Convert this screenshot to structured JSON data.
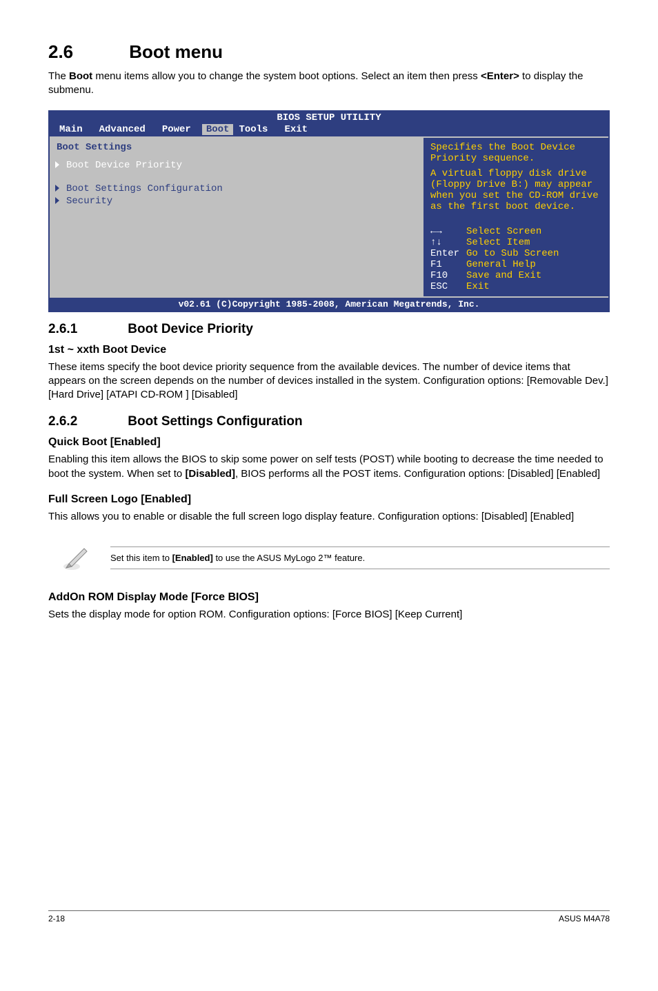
{
  "section_number": "2.6",
  "section_title": "Boot menu",
  "intro_text_1": "The ",
  "intro_bold_1": "Boot",
  "intro_text_2": " menu items allow you to change the system boot options. Select an item then press ",
  "intro_bold_2": "<Enter>",
  "intro_text_3": " to display the submenu.",
  "bios": {
    "title": "BIOS SETUP UTILITY",
    "menu": [
      "Main",
      "Advanced",
      "Power",
      "Boot",
      "Tools",
      "Exit"
    ],
    "selected_menu_index": 3,
    "left_heading": "Boot Settings",
    "items": [
      {
        "label": "Boot Device Priority",
        "highlight": true
      },
      {
        "label": "Boot Settings Configuration",
        "highlight": false
      },
      {
        "label": "Security",
        "highlight": false
      }
    ],
    "help_top": "Specifies the Boot Device Priority sequence.",
    "help_extra": "A virtual floppy disk drive (Floppy Drive B:) may appear when you set the CD-ROM drive as the first boot device.",
    "legend": [
      {
        "key_glyph": "←→",
        "label": "Select Screen"
      },
      {
        "key_glyph": "↑↓",
        "label": "Select Item"
      },
      {
        "key_glyph": "Enter",
        "label": "Go to Sub Screen"
      },
      {
        "key_glyph": "F1",
        "label": "General Help"
      },
      {
        "key_glyph": "F10",
        "label": "Save and Exit"
      },
      {
        "key_glyph": "ESC",
        "label": "Exit"
      }
    ],
    "footer": "v02.61 (C)Copyright 1985-2008, American Megatrends, Inc."
  },
  "sub1_number": "2.6.1",
  "sub1_title": "Boot Device Priority",
  "sub1_h3": "1st ~ xxth Boot Device",
  "sub1_text": "These items specify the boot device priority sequence from the available devices. The number of device items that appears on the screen depends on the number of devices installed in the system. Configuration options: [Removable Dev.] [Hard Drive] [ATAPI CD-ROM ] [Disabled]",
  "sub2_number": "2.6.2",
  "sub2_title": "Boot Settings Configuration",
  "quickboot_h3": "Quick Boot [Enabled]",
  "quickboot_text_1": "Enabling this item allows the BIOS to skip some power on self tests (POST) while booting to decrease the time needed to boot the system. When set to ",
  "quickboot_bold": "[Disabled]",
  "quickboot_text_2": ", BIOS performs all the POST items. Configuration options: [Disabled] [Enabled]",
  "fullscreen_h3": "Full Screen Logo [Enabled]",
  "fullscreen_text": "This allows you to enable or disable the full screen logo display feature. Configuration options: [Disabled] [Enabled]",
  "note_text_1": "Set this item to ",
  "note_bold": "[Enabled]",
  "note_text_2": " to use the ASUS MyLogo 2™ feature.",
  "addon_h3": "AddOn ROM Display Mode [Force BIOS]",
  "addon_text": "Sets the display mode for option ROM. Configuration options: [Force BIOS] [Keep Current]",
  "footer_left": "2-18",
  "footer_right": "ASUS M4A78"
}
